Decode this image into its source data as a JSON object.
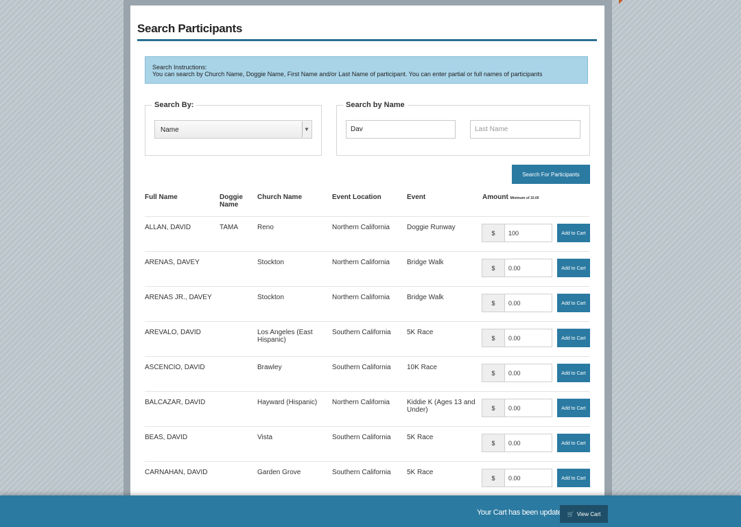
{
  "page": {
    "title": "Search Participants"
  },
  "instructions": {
    "heading": "Search Instructions:",
    "text": "You can search by Church Name, Doggie Name, First Name and/or Last Name of participant. You can enter partial or full names of participants"
  },
  "search_by": {
    "legend": "Search By:",
    "selected": "Name"
  },
  "search_by_name": {
    "legend": "Search by Name",
    "first_name_value": "Dav",
    "last_name_placeholder": "Last Name"
  },
  "search_button_label": "Search For Participants",
  "table": {
    "headers": {
      "full_name": "Full Name",
      "doggie_name": "Doggie Name",
      "church_name": "Church Name",
      "event_location": "Event Location",
      "event": "Event",
      "amount": "Amount",
      "amount_note": "Minimum of 10.00"
    },
    "currency_symbol": "$",
    "add_to_cart_label": "Add to Cart",
    "rows": [
      {
        "full_name": "ALLAN, DAVID",
        "doggie_name": "TAMA",
        "church": "Reno",
        "location": "Northern California",
        "event": "Doggie Runway",
        "amount": "100"
      },
      {
        "full_name": "ARENAS, DAVEY",
        "doggie_name": "",
        "church": "Stockton",
        "location": "Northern California",
        "event": "Bridge Walk",
        "amount": "0.00"
      },
      {
        "full_name": "ARENAS JR., DAVEY",
        "doggie_name": "",
        "church": "Stockton",
        "location": "Northern California",
        "event": "Bridge Walk",
        "amount": "0.00"
      },
      {
        "full_name": "AREVALO, DAVID",
        "doggie_name": "",
        "church": "Los Angeles (East Hispanic)",
        "location": "Southern California",
        "event": "5K Race",
        "amount": "0.00"
      },
      {
        "full_name": "ASCENCIO, DAVID",
        "doggie_name": "",
        "church": "Brawley",
        "location": "Southern California",
        "event": "10K Race",
        "amount": "0.00"
      },
      {
        "full_name": "BALCAZAR, DAVID",
        "doggie_name": "",
        "church": "Hayward (Hispanic)",
        "location": "Northern California",
        "event": "Kiddie K (Ages 13 and Under)",
        "amount": "0.00"
      },
      {
        "full_name": "BEAS, DAVID",
        "doggie_name": "",
        "church": "Vista",
        "location": "Southern California",
        "event": "5K Race",
        "amount": "0.00"
      },
      {
        "full_name": "CARNAHAN, DAVID",
        "doggie_name": "",
        "church": "Garden Grove",
        "location": "Southern California",
        "event": "5K Race",
        "amount": "0.00"
      }
    ]
  },
  "cart_bar": {
    "message": "Your Cart has been updated",
    "view_cart_label": "View Cart",
    "cart_icon_glyph": "🛒"
  },
  "colors": {
    "accent": "#2a7aa2",
    "info_background": "#a9d4e8",
    "bottom_bar": "#2b7aa1"
  }
}
